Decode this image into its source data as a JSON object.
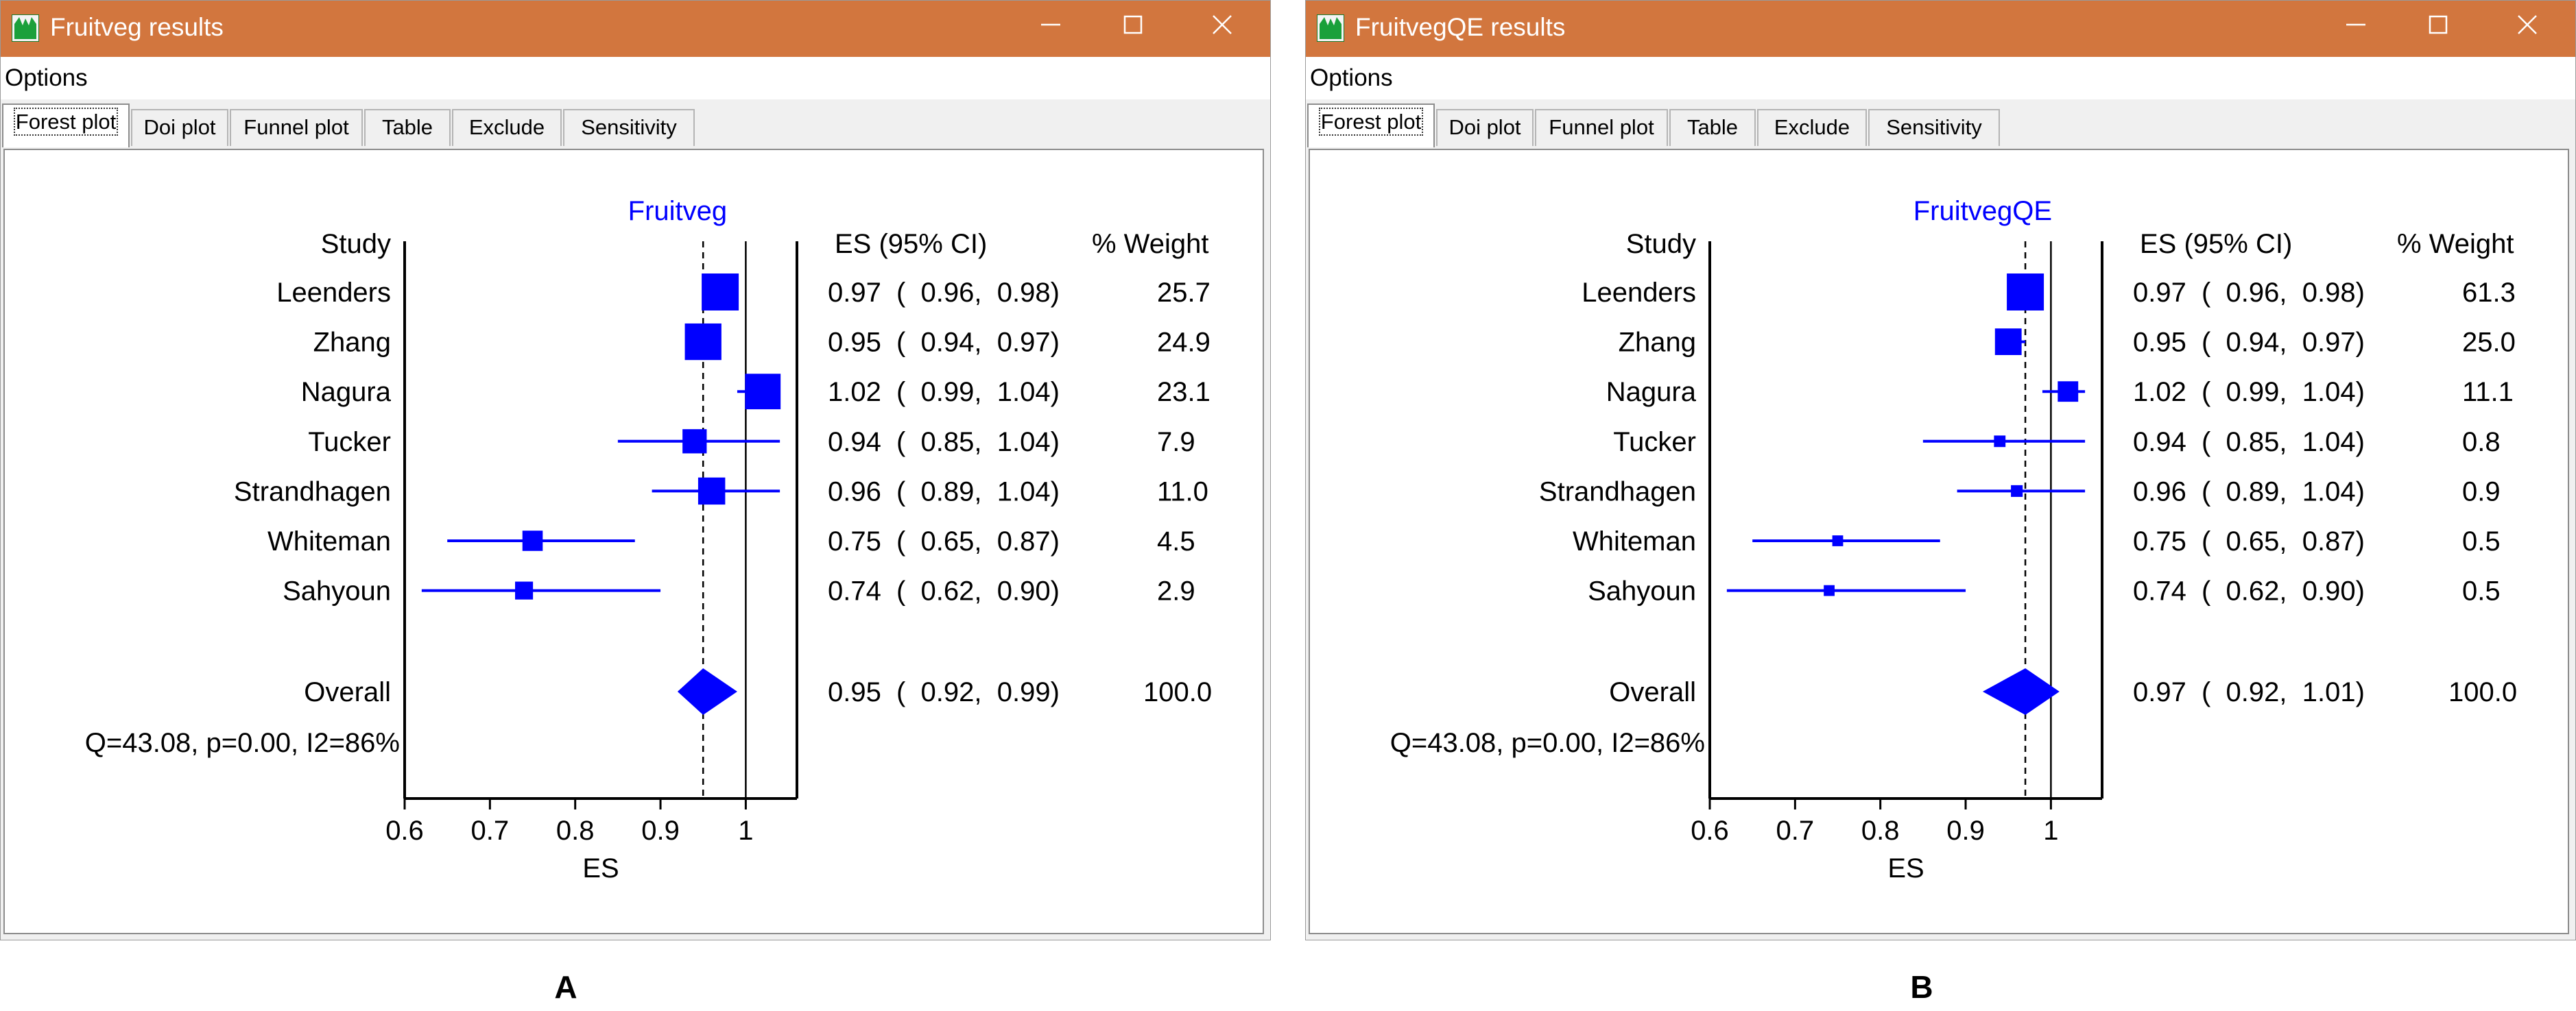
{
  "colors": {
    "accent": "#0000ff",
    "titlebar": "#d2763e",
    "line": "#000000"
  },
  "windows": [
    {
      "title": "Fruitveg results",
      "menu": "Options",
      "tabs": [
        "Forest plot",
        "Doi plot",
        "Funnel plot",
        "Table",
        "Exclude",
        "Sensitivity"
      ],
      "active_tab": 0,
      "icons": {
        "app": "app-icon",
        "minimize": "minimize-icon",
        "maximize": "maximize-icon",
        "close": "close-icon"
      }
    },
    {
      "title": "FruitvegQE results",
      "menu": "Options",
      "tabs": [
        "Forest plot",
        "Doi plot",
        "Funnel plot",
        "Table",
        "Exclude",
        "Sensitivity"
      ],
      "active_tab": 0,
      "icons": {
        "app": "app-icon",
        "minimize": "minimize-icon",
        "maximize": "maximize-icon",
        "close": "close-icon"
      }
    }
  ],
  "panel_labels": [
    "A",
    "B"
  ],
  "chart_data": [
    {
      "type": "forest",
      "title": "Fruitveg",
      "xlabel": "ES",
      "study_header": "Study",
      "es_header": "ES (95% CI)",
      "weight_header": "% Weight",
      "xlim": [
        0.6,
        1.06
      ],
      "xticks": [
        0.6,
        0.7,
        0.8,
        0.9,
        1
      ],
      "xtick_labels": [
        "0.6",
        "0.7",
        "0.8",
        "0.9",
        "1"
      ],
      "null_line": 1,
      "pooled_line": 0.95,
      "studies": [
        {
          "name": "Leenders",
          "es": 0.97,
          "lo": 0.96,
          "hi": 0.98,
          "weight": 25.7,
          "es_text": "0.97",
          "ci_text": "(  0.96,  0.98)",
          "weight_text": "25.7"
        },
        {
          "name": "Zhang",
          "es": 0.95,
          "lo": 0.94,
          "hi": 0.97,
          "weight": 24.9,
          "es_text": "0.95",
          "ci_text": "(  0.94,  0.97)",
          "weight_text": "24.9"
        },
        {
          "name": "Nagura",
          "es": 1.02,
          "lo": 0.99,
          "hi": 1.04,
          "weight": 23.1,
          "es_text": "1.02",
          "ci_text": "(  0.99,  1.04)",
          "weight_text": "23.1"
        },
        {
          "name": "Tucker",
          "es": 0.94,
          "lo": 0.85,
          "hi": 1.04,
          "weight": 7.9,
          "es_text": "0.94",
          "ci_text": "(  0.85,  1.04)",
          "weight_text": "7.9"
        },
        {
          "name": "Strandhagen",
          "es": 0.96,
          "lo": 0.89,
          "hi": 1.04,
          "weight": 11.0,
          "es_text": "0.96",
          "ci_text": "(  0.89,  1.04)",
          "weight_text": "11.0"
        },
        {
          "name": "Whiteman",
          "es": 0.75,
          "lo": 0.65,
          "hi": 0.87,
          "weight": 4.5,
          "es_text": "0.75",
          "ci_text": "(  0.65,  0.87)",
          "weight_text": "4.5"
        },
        {
          "name": "Sahyoun",
          "es": 0.74,
          "lo": 0.62,
          "hi": 0.9,
          "weight": 2.9,
          "es_text": "0.74",
          "ci_text": "(  0.62,  0.90)",
          "weight_text": "2.9"
        }
      ],
      "overall": {
        "name": "Overall",
        "es": 0.95,
        "lo": 0.92,
        "hi": 0.99,
        "weight": 100.0,
        "es_text": "0.95",
        "ci_text": "(  0.92,  0.99)",
        "weight_text": "100.0"
      },
      "heterogeneity": "Q=43.08, p=0.00, I2=86%"
    },
    {
      "type": "forest",
      "title": "FruitvegQE",
      "xlabel": "ES",
      "study_header": "Study",
      "es_header": "ES (95% CI)",
      "weight_header": "% Weight",
      "xlim": [
        0.6,
        1.06
      ],
      "xticks": [
        0.6,
        0.7,
        0.8,
        0.9,
        1
      ],
      "xtick_labels": [
        "0.6",
        "0.7",
        "0.8",
        "0.9",
        "1"
      ],
      "null_line": 1,
      "pooled_line": 0.97,
      "studies": [
        {
          "name": "Leenders",
          "es": 0.97,
          "lo": 0.96,
          "hi": 0.98,
          "weight": 61.3,
          "es_text": "0.97",
          "ci_text": "(  0.96,  0.98)",
          "weight_text": "61.3"
        },
        {
          "name": "Zhang",
          "es": 0.95,
          "lo": 0.94,
          "hi": 0.97,
          "weight": 25.0,
          "es_text": "0.95",
          "ci_text": "(  0.94,  0.97)",
          "weight_text": "25.0"
        },
        {
          "name": "Nagura",
          "es": 1.02,
          "lo": 0.99,
          "hi": 1.04,
          "weight": 11.1,
          "es_text": "1.02",
          "ci_text": "(  0.99,  1.04)",
          "weight_text": "11.1"
        },
        {
          "name": "Tucker",
          "es": 0.94,
          "lo": 0.85,
          "hi": 1.04,
          "weight": 0.8,
          "es_text": "0.94",
          "ci_text": "(  0.85,  1.04)",
          "weight_text": "0.8"
        },
        {
          "name": "Strandhagen",
          "es": 0.96,
          "lo": 0.89,
          "hi": 1.04,
          "weight": 0.9,
          "es_text": "0.96",
          "ci_text": "(  0.89,  1.04)",
          "weight_text": "0.9"
        },
        {
          "name": "Whiteman",
          "es": 0.75,
          "lo": 0.65,
          "hi": 0.87,
          "weight": 0.5,
          "es_text": "0.75",
          "ci_text": "(  0.65,  0.87)",
          "weight_text": "0.5"
        },
        {
          "name": "Sahyoun",
          "es": 0.74,
          "lo": 0.62,
          "hi": 0.9,
          "weight": 0.5,
          "es_text": "0.74",
          "ci_text": "(  0.62,  0.90)",
          "weight_text": "0.5"
        }
      ],
      "overall": {
        "name": "Overall",
        "es": 0.97,
        "lo": 0.92,
        "hi": 1.01,
        "weight": 100.0,
        "es_text": "0.97",
        "ci_text": "(  0.92,  1.01)",
        "weight_text": "100.0"
      },
      "heterogeneity": "Q=43.08, p=0.00, I2=86%"
    }
  ]
}
